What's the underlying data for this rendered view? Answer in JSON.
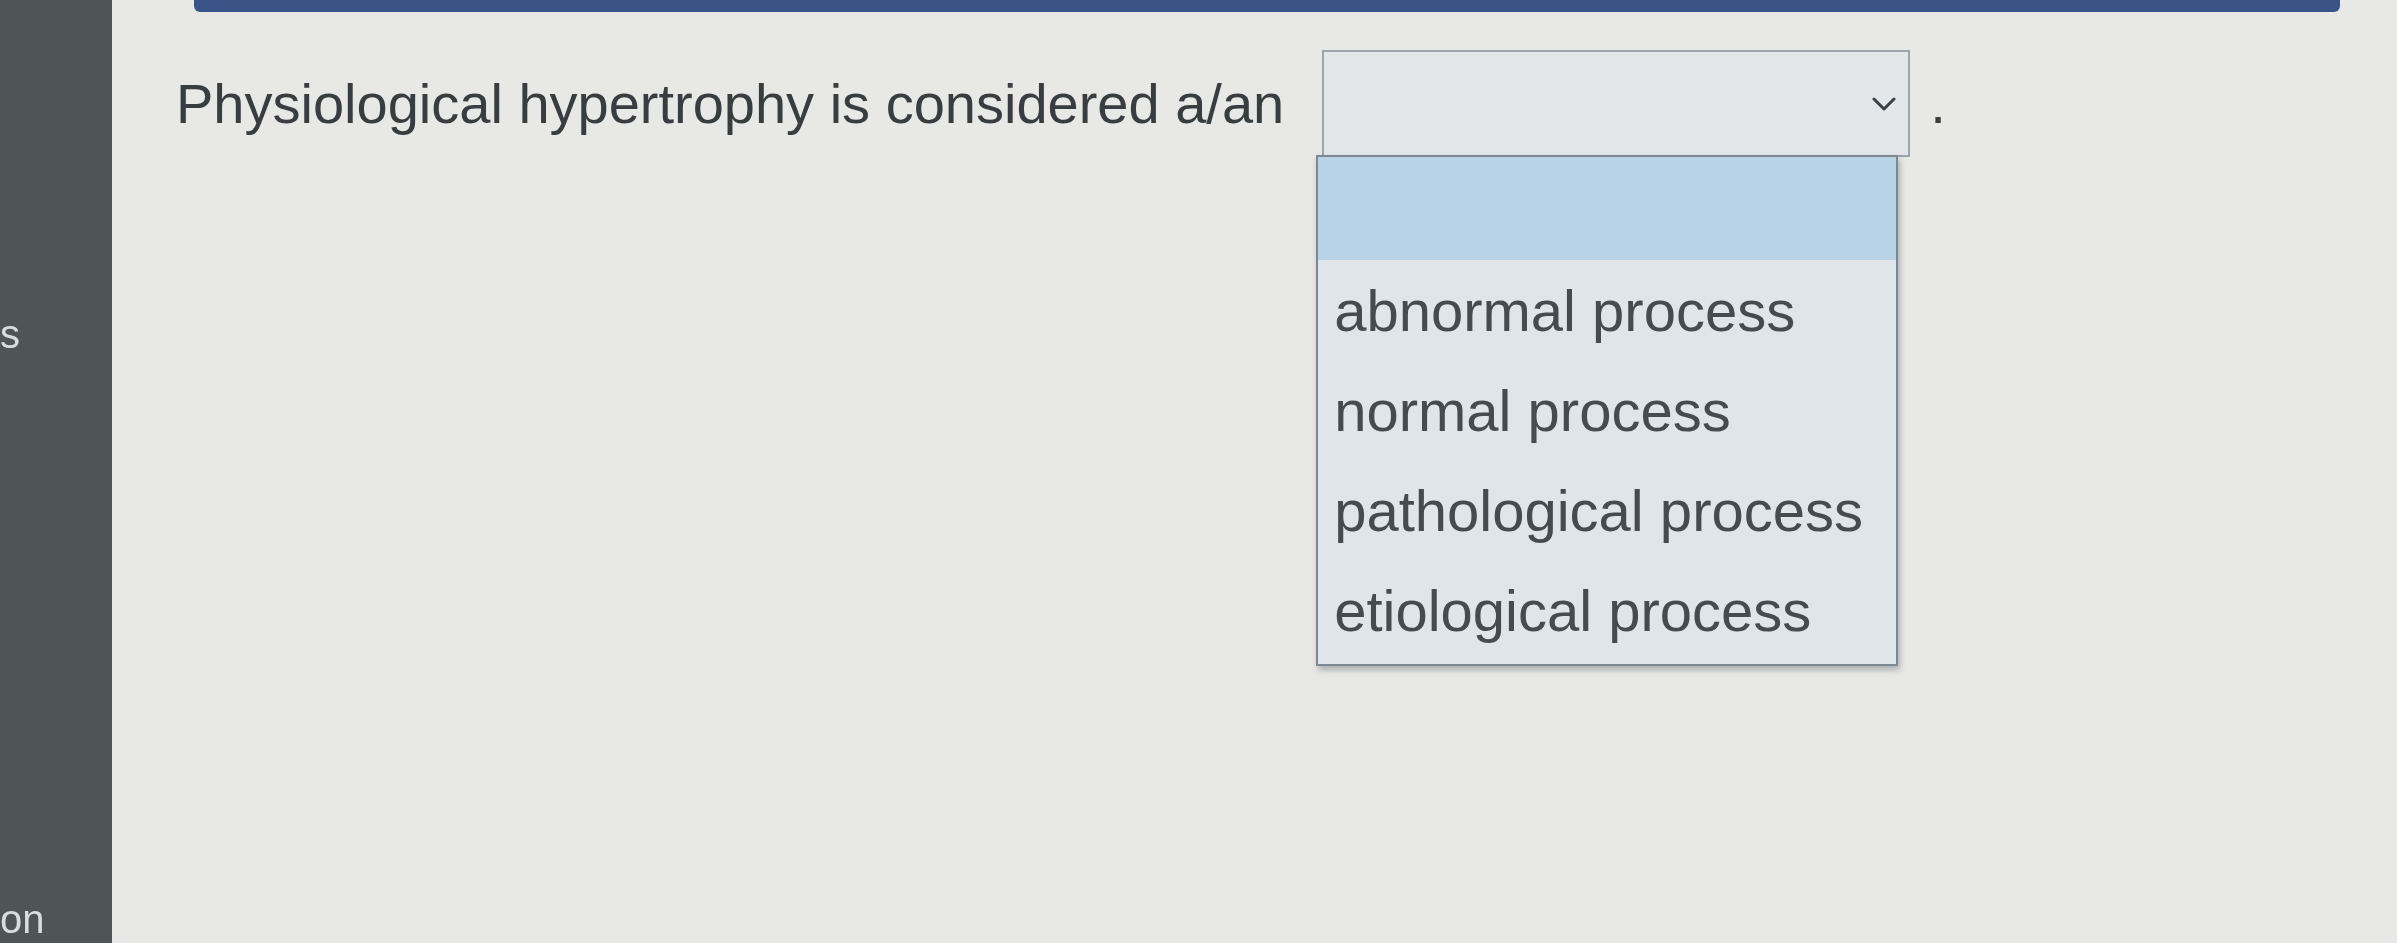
{
  "sidebar": {
    "items": [
      "s",
      "on"
    ]
  },
  "question": {
    "text_before": "Physiological hypertrophy is considered a/an",
    "text_after": ".",
    "dropdown": {
      "expanded": true,
      "options": [
        {
          "kind": "blank",
          "selected": true
        },
        {
          "kind": "option",
          "label": "abnormal process",
          "selected": false
        },
        {
          "kind": "option",
          "label": "normal process",
          "selected": false
        },
        {
          "kind": "option",
          "label": "pathological process",
          "selected": false
        },
        {
          "kind": "option",
          "label": "etiological process",
          "selected": false
        }
      ]
    }
  }
}
